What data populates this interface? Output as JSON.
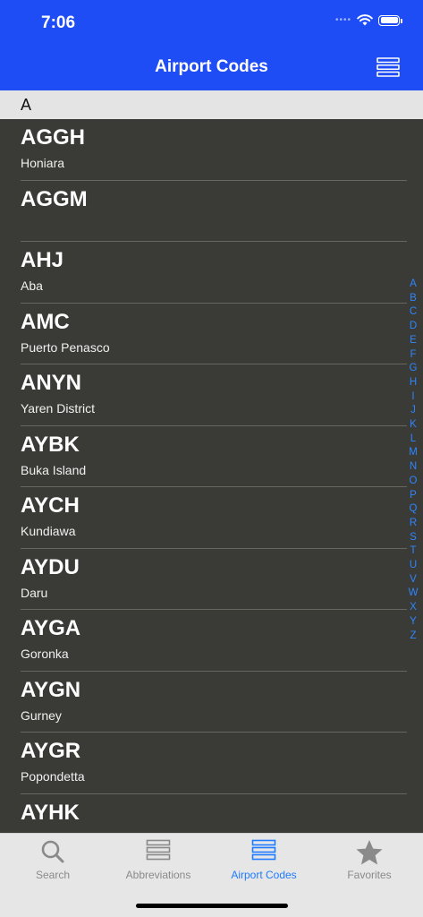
{
  "status": {
    "time": "7:06",
    "signal": "••••"
  },
  "nav": {
    "title": "Airport Codes",
    "menu_icon": "list-icon"
  },
  "section": {
    "letter": "A"
  },
  "airports": [
    {
      "code": "AGGH",
      "city": "Honiara"
    },
    {
      "code": "AGGM",
      "city": ""
    },
    {
      "code": "AHJ",
      "city": "Aba"
    },
    {
      "code": "AMC",
      "city": "Puerto Penasco"
    },
    {
      "code": "ANYN",
      "city": "Yaren District"
    },
    {
      "code": "AYBK",
      "city": "Buka Island"
    },
    {
      "code": "AYCH",
      "city": "Kundiawa"
    },
    {
      "code": "AYDU",
      "city": "Daru"
    },
    {
      "code": "AYGA",
      "city": "Goronka"
    },
    {
      "code": "AYGN",
      "city": "Gurney"
    },
    {
      "code": "AYGR",
      "city": "Popondetta"
    },
    {
      "code": "AYHK",
      "city": ""
    }
  ],
  "index_letters": [
    "A",
    "B",
    "C",
    "D",
    "E",
    "F",
    "G",
    "H",
    "I",
    "J",
    "K",
    "L",
    "M",
    "N",
    "O",
    "P",
    "Q",
    "R",
    "S",
    "T",
    "U",
    "V",
    "W",
    "X",
    "Y",
    "Z"
  ],
  "tabs": [
    {
      "label": "Search",
      "icon": "search-icon"
    },
    {
      "label": "Abbreviations",
      "icon": "list-icon"
    },
    {
      "label": "Airport Codes",
      "icon": "list-icon",
      "active": true
    },
    {
      "label": "Favorites",
      "icon": "star-icon"
    }
  ],
  "colors": {
    "nav_bar": "#1f4df5",
    "list_bg": "#3a3a36",
    "accent": "#1f7bff"
  }
}
